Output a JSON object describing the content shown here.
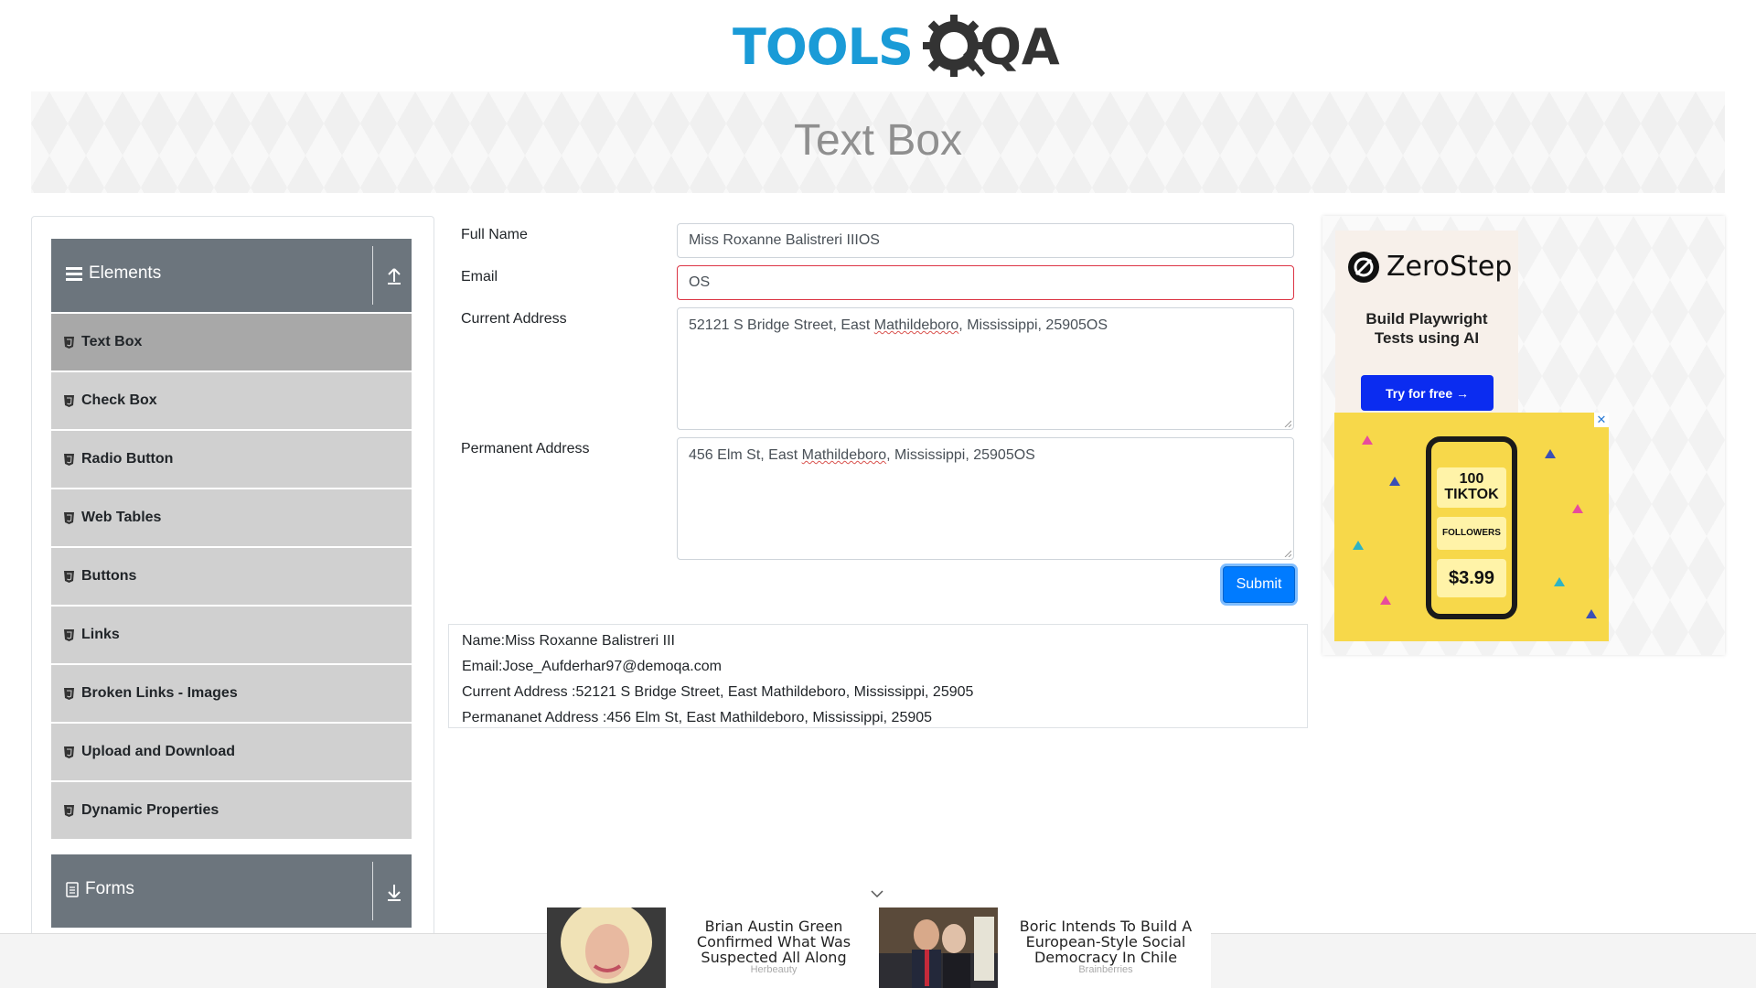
{
  "header": {
    "logo_tools": "TOOLS",
    "logo_qa": "QA"
  },
  "banner": {
    "title": "Text Box"
  },
  "sidebar": {
    "elements_group": {
      "label": "Elements",
      "expanded": true
    },
    "items": [
      {
        "label": "Text Box",
        "active": true
      },
      {
        "label": "Check Box"
      },
      {
        "label": "Radio Button"
      },
      {
        "label": "Web Tables"
      },
      {
        "label": "Buttons"
      },
      {
        "label": "Links"
      },
      {
        "label": "Broken Links - Images"
      },
      {
        "label": "Upload and Download"
      },
      {
        "label": "Dynamic Properties"
      }
    ],
    "forms_group": {
      "label": "Forms",
      "expanded": false
    }
  },
  "form": {
    "full_name": {
      "label": "Full Name",
      "value": "Miss Roxanne Balistreri IIIOS"
    },
    "email": {
      "label": "Email",
      "value": "OS",
      "invalid": true
    },
    "current_address": {
      "label": "Current Address",
      "value_before": "52121 S Bridge Street, East ",
      "value_misspelled": "Mathildeboro",
      "value_after": ", Mississippi, 25905OS"
    },
    "permanent_address": {
      "label": "Permanent Address",
      "value_before": "456 Elm St, East ",
      "value_misspelled": "Mathildeboro",
      "value_after": ", Mississippi, 25905OS"
    },
    "submit_label": "Submit"
  },
  "output": {
    "name": "Name:Miss Roxanne Balistreri III",
    "email": "Email:Jose_Aufderhar97@demoqa.com",
    "current_address": "Current Address :52121 S Bridge Street, East Mathildeboro, Mississippi, 25905",
    "permanent_address": "Permananet Address :456 Elm St, East Mathildeboro, Mississippi, 25905"
  },
  "right_ad": {
    "brand": "ZeroStep",
    "tagline_line1": "Build Playwright",
    "tagline_line2": "Tests using AI",
    "cta": "Try for free →",
    "tiktok_followers_count": "100",
    "tiktok_brand": "TIKTOK",
    "tiktok_followers": "FOLLOWERS",
    "tiktok_price": "$3.99",
    "close_glyph": "✕"
  },
  "bottom_ad": {
    "items": [
      {
        "title": "Brian Austin Green Confirmed What Was Suspected All Along",
        "source": "Herbeauty"
      },
      {
        "title": "Boric Intends To Build A European-Style Social Democracy In Chile",
        "source": "Brainberries"
      }
    ]
  },
  "colors": {
    "primary": "#007bff",
    "sidebar_header": "#6c757d",
    "menu_item": "#d0d0d0",
    "menu_item_active": "#a8a8a8",
    "invalid": "#dc3545",
    "logo_blue": "#1a9bd7"
  },
  "icons": {
    "elements": "hamburger-menu-icon",
    "collapse": "upload-arrow-icon",
    "forms": "document-icon",
    "expand": "download-arrow-icon",
    "menu_item": "html5-shield-icon"
  }
}
